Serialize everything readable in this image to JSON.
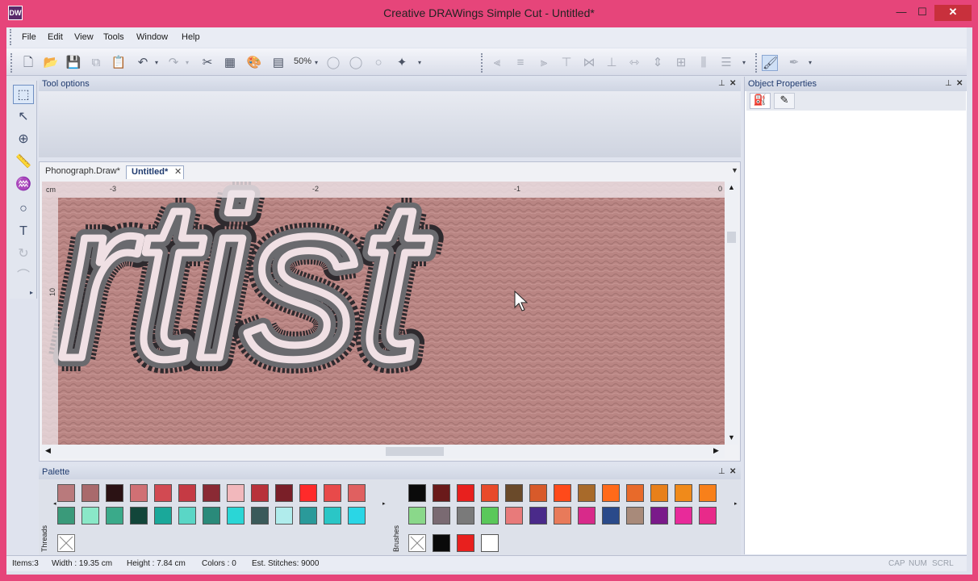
{
  "window": {
    "title": "Creative DRAWings Simple Cut - Untitled*",
    "app_icon": "DW",
    "min": "—",
    "max": "☐",
    "close": "✕"
  },
  "menu": [
    "File",
    "Edit",
    "View",
    "Tools",
    "Window",
    "Help"
  ],
  "toolbar": {
    "zoom": "50%"
  },
  "tool_options": {
    "title": "Tool options"
  },
  "object_properties": {
    "title": "Object Properties"
  },
  "tabs": [
    {
      "label": "Phonograph.Draw*"
    },
    {
      "label": "Untitled*"
    }
  ],
  "canvas": {
    "text": "rtist",
    "ruler_unit": "cm",
    "ruler_top": [
      "-3",
      "-2",
      "-1",
      "0"
    ],
    "ruler_left": [
      "10"
    ]
  },
  "palette": {
    "title": "Palette",
    "threads_label": "Threads",
    "brushes_label": "Brushes",
    "threads_row1": [
      "#b97a7c",
      "#a96a6c",
      "#2b1214",
      "#d07074",
      "#d24a52",
      "#c53a44",
      "#8a2a34",
      "#f2b8bc",
      "#b8323a",
      "#7a1f28",
      "#ff2a2a",
      "#e84a4a",
      "#e06060"
    ],
    "threads_row2": [
      "#3a9a7a",
      "#8ae8c8",
      "#3aaa8a",
      "#12463a",
      "#1aa89a",
      "#5ad6c6",
      "#2a8a7a",
      "#2ad6d6",
      "#3a5a5a",
      "#b0ecec",
      "#2a9a9a",
      "#2ac6c6",
      "#2ad6e6"
    ],
    "brushes_row1": [
      "#0a0a0a",
      "#6a1a1a",
      "#e8201e",
      "#e84a2a",
      "#6a4a2a",
      "#d85a2a",
      "#ff4a1a",
      "#a86a2a",
      "#ff6a1a",
      "#e86a2a",
      "#e8801a",
      "#f08a1a",
      "#f8801a"
    ],
    "brushes_row2": [
      "#8ad88a",
      "#7a6a72",
      "#7a7a7a",
      "#5ac85a",
      "#e87a7a",
      "#4a2a8a",
      "#e87a5a",
      "#d82a8a",
      "#2a4a8a",
      "#a88a7a",
      "#7a1a8a",
      "#e82a9a",
      "#e82a8a"
    ],
    "brushes_fill": [
      "#0a0a0a",
      "#e8201e",
      "#ffffff"
    ]
  },
  "status": {
    "items": "Items:3",
    "width": "Width : 19.35 cm",
    "height": "Height : 7.84 cm",
    "colors": "Colors : 0",
    "stitches": "Est. Stitches: 9000",
    "cap": "CAP",
    "num": "NUM",
    "scrl": "SCRL"
  },
  "colors": {
    "title_bar": "#e6457a",
    "canvas_bg": "#b98583",
    "stroke_dark": "#2e2a2e",
    "stroke_mid": "#6a6a6e",
    "stroke_light": "#f0e0e4"
  }
}
